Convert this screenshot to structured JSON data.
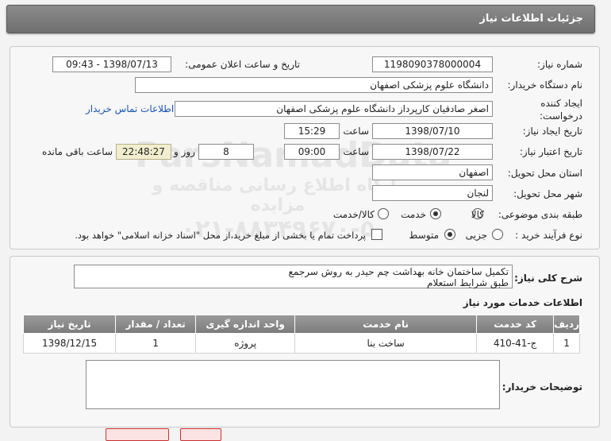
{
  "header": {
    "title": "جزئیات اطلاعات نیاز"
  },
  "form": {
    "need_number": {
      "label": "شماره نیاز:",
      "value": "1198090378000004"
    },
    "announce": {
      "label": "تاریخ و ساعت اعلان عمومی:",
      "value": "1398/07/13 - 09:43"
    },
    "buyer_org": {
      "label": "نام دستگاه خریدار:",
      "value": "دانشگاه علوم پزشکی اصفهان"
    },
    "creator": {
      "label": "ایجاد کننده درخواست:",
      "value": "اصغر صادقیان کارپرداز دانشگاه علوم پزشکی اصفهان",
      "contact_link": "اطلاعات تماس خریدار"
    },
    "created": {
      "label": "تاریخ ایجاد نیاز:",
      "date": "1398/07/10",
      "time_label": "ساعت",
      "time": "15:29"
    },
    "validity": {
      "label": "تاریخ اعتبار نیاز:",
      "date": "1398/07/22",
      "time_label": "ساعت",
      "time": "09:00",
      "days": "8",
      "days_label": "روز و",
      "remaining": "22:48:27",
      "remaining_label": "ساعت باقی مانده"
    },
    "province": {
      "label": "استان محل تحویل:",
      "value": "اصفهان"
    },
    "city": {
      "label": "شهر محل تحویل:",
      "value": "لنجان"
    },
    "category": {
      "label": "طبقه بندی موضوعی:",
      "options": [
        "کالا",
        "خدمت",
        "کالا/خدمت"
      ],
      "selected": "خدمت"
    },
    "process": {
      "label": "نوع فرآیند خرید :",
      "options": [
        "جزیی",
        "متوسط"
      ],
      "selected": "متوسط",
      "payment_note": "پرداخت تمام یا بخشی از مبلغ خرید،از محل \"اسناد خزانه اسلامی\" خواهد بود."
    }
  },
  "description": {
    "label": "شرح کلی نیاز:",
    "lines": [
      "تکمیل ساختمان خانه بهداشت چم حیدر به روش سرجمع",
      "طبق شرایط استعلام"
    ]
  },
  "services": {
    "title": "اطلاعات خدمات مورد نیاز",
    "columns": [
      "ردیف",
      "کد خدمت",
      "نام خدمت",
      "واحد اندازه گیری",
      "تعداد / مقدار",
      "تاریخ نیاز"
    ],
    "rows": [
      [
        "1",
        "ج-41-410",
        "ساخت بنا",
        "پروژه",
        "1",
        "1398/12/15"
      ]
    ]
  },
  "buyer_notes": {
    "label": "توضیحات خریدار:",
    "value": ""
  },
  "watermark": {
    "lines": [
      "ParsNamadData",
      "پایگاه اطلاع رسانی مناقصه و مزایده",
      "۰۲۱-۸۸۳۴۹۶۷۰-۵"
    ]
  }
}
